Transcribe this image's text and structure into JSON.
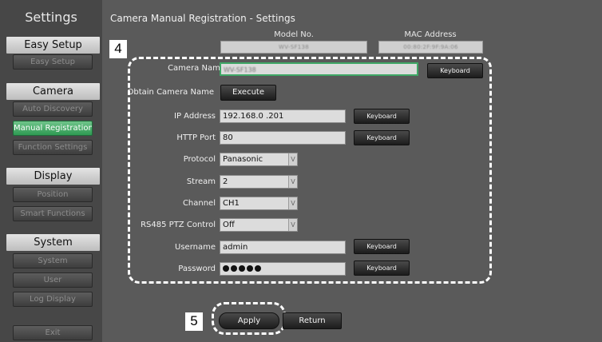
{
  "sidebar": {
    "title": "Settings",
    "sections": [
      {
        "header": "Easy Setup",
        "buttons": [
          "Easy Setup"
        ]
      },
      {
        "header": "Camera",
        "buttons": [
          "Auto Discovery",
          "Manual Registration",
          "Function Settings"
        ]
      },
      {
        "header": "Display",
        "buttons": [
          "Position",
          "Smart Functions"
        ]
      },
      {
        "header": "System",
        "buttons": [
          "System",
          "User",
          "Log Display",
          "Exit"
        ]
      }
    ],
    "active_item": "Manual Registration"
  },
  "page": {
    "title": "Camera Manual Registration - Settings",
    "model_no_label": "Model No.",
    "model_no_value": "WV-SF138",
    "mac_label": "MAC Address",
    "mac_value": "00:80:2F:9F:9A:06"
  },
  "form": {
    "camera_name_label": "Camera Name",
    "camera_name_value": "WV-SF138",
    "obtain_label": "Obtain Camera Name",
    "execute_label": "Execute",
    "ip_label": "IP Address",
    "ip_value": "192.168.0  .201",
    "http_port_label": "HTTP Port",
    "http_port_value": "80",
    "protocol_label": "Protocol",
    "protocol_value": "Panasonic",
    "stream_label": "Stream",
    "stream_value": "2",
    "channel_label": "Channel",
    "channel_value": "CH1",
    "rs485_label": "RS485 PTZ Control",
    "rs485_value": "Off",
    "username_label": "Username",
    "username_value": "admin",
    "password_label": "Password",
    "keyboard_label": "Keyboard",
    "select_arrow": "V"
  },
  "actions": {
    "apply_label": "Apply",
    "return_label": "Return"
  },
  "callouts": {
    "form_number": "4",
    "apply_number": "5"
  },
  "colors": {
    "active_green": "#3fa766",
    "panel_bg": "#5a5a5a",
    "sidebar_bg": "#474747"
  }
}
